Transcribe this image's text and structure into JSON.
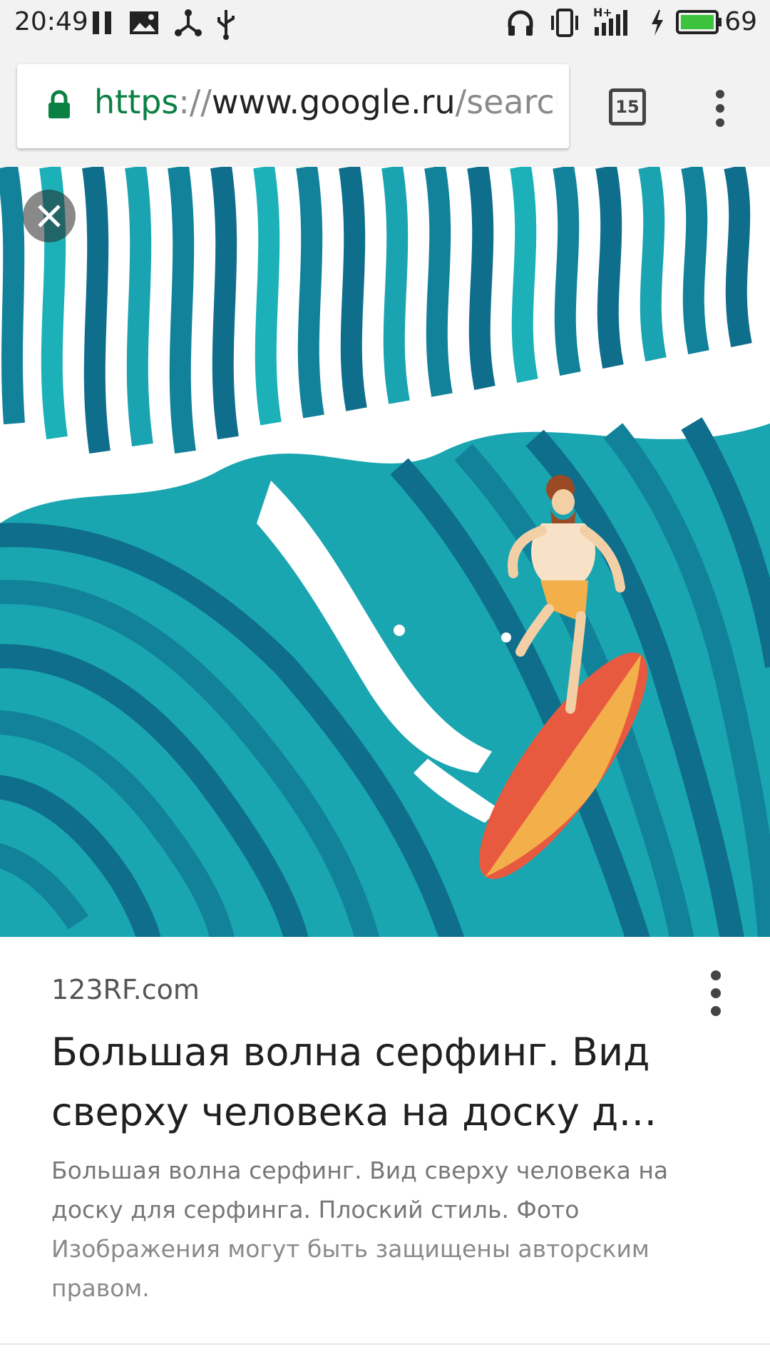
{
  "status_bar": {
    "time": "20:49",
    "battery_level": "69",
    "network_type": "H+",
    "icons": [
      "pause-icon",
      "gallery-icon",
      "share-network-icon",
      "usb-icon",
      "headphones-icon",
      "vibrate-icon",
      "signal-icon",
      "charging-icon",
      "battery-icon"
    ]
  },
  "browser": {
    "url_scheme": "https",
    "url_separator": "://",
    "url_host": "www.google.ru",
    "url_path": "/search",
    "tab_count": "15",
    "lock_color": "#0b8043"
  },
  "image_viewer": {
    "close_icon": "close-icon",
    "illustration": "surfer-wave-illustration"
  },
  "result": {
    "source": "123RF.com",
    "title": "Большая волна серфинг. Вид сверху человека на доску д…",
    "description": "Большая волна серфинг. Вид сверху человека на доску для серфинга. Плоский стиль. Фото",
    "copyright_notice": "Изображения могут быть защищены авторским правом."
  }
}
